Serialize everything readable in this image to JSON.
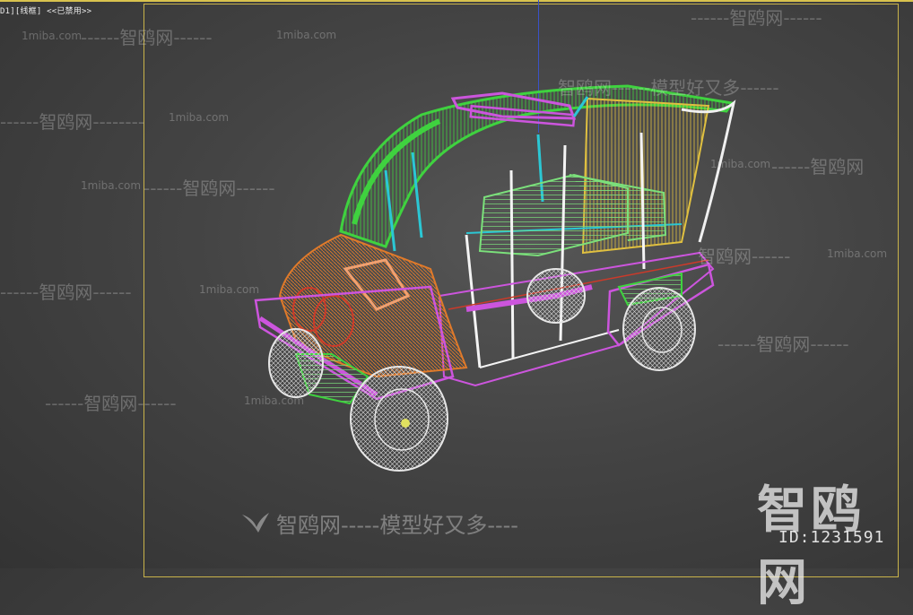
{
  "viewport": {
    "label": "D1][线框] <<已禁用>>"
  },
  "watermarks": {
    "brand": "智鸥网",
    "domain": "1miba.com",
    "slogan": "模型好又多",
    "dashes_short": "------",
    "dashes_long": "--------"
  },
  "footer": {
    "watermark_brand": "智鸥网",
    "watermark_dashes": "-----",
    "watermark_slogan": "模型好又多",
    "watermark_tail": "----",
    "logo": "智鸥网",
    "id": "ID:1231591"
  },
  "colors": {
    "frame": "#c9b34a",
    "body_green": "#3fd23f",
    "glass_cyan": "#2bc7d4",
    "purple": "#cc55dd",
    "orange": "#e07a2a",
    "yellow_seat": "#e0c040",
    "wheel_white": "#e6e6e6",
    "red": "#cc3a2a",
    "axis_blue": "#3a52c8"
  }
}
